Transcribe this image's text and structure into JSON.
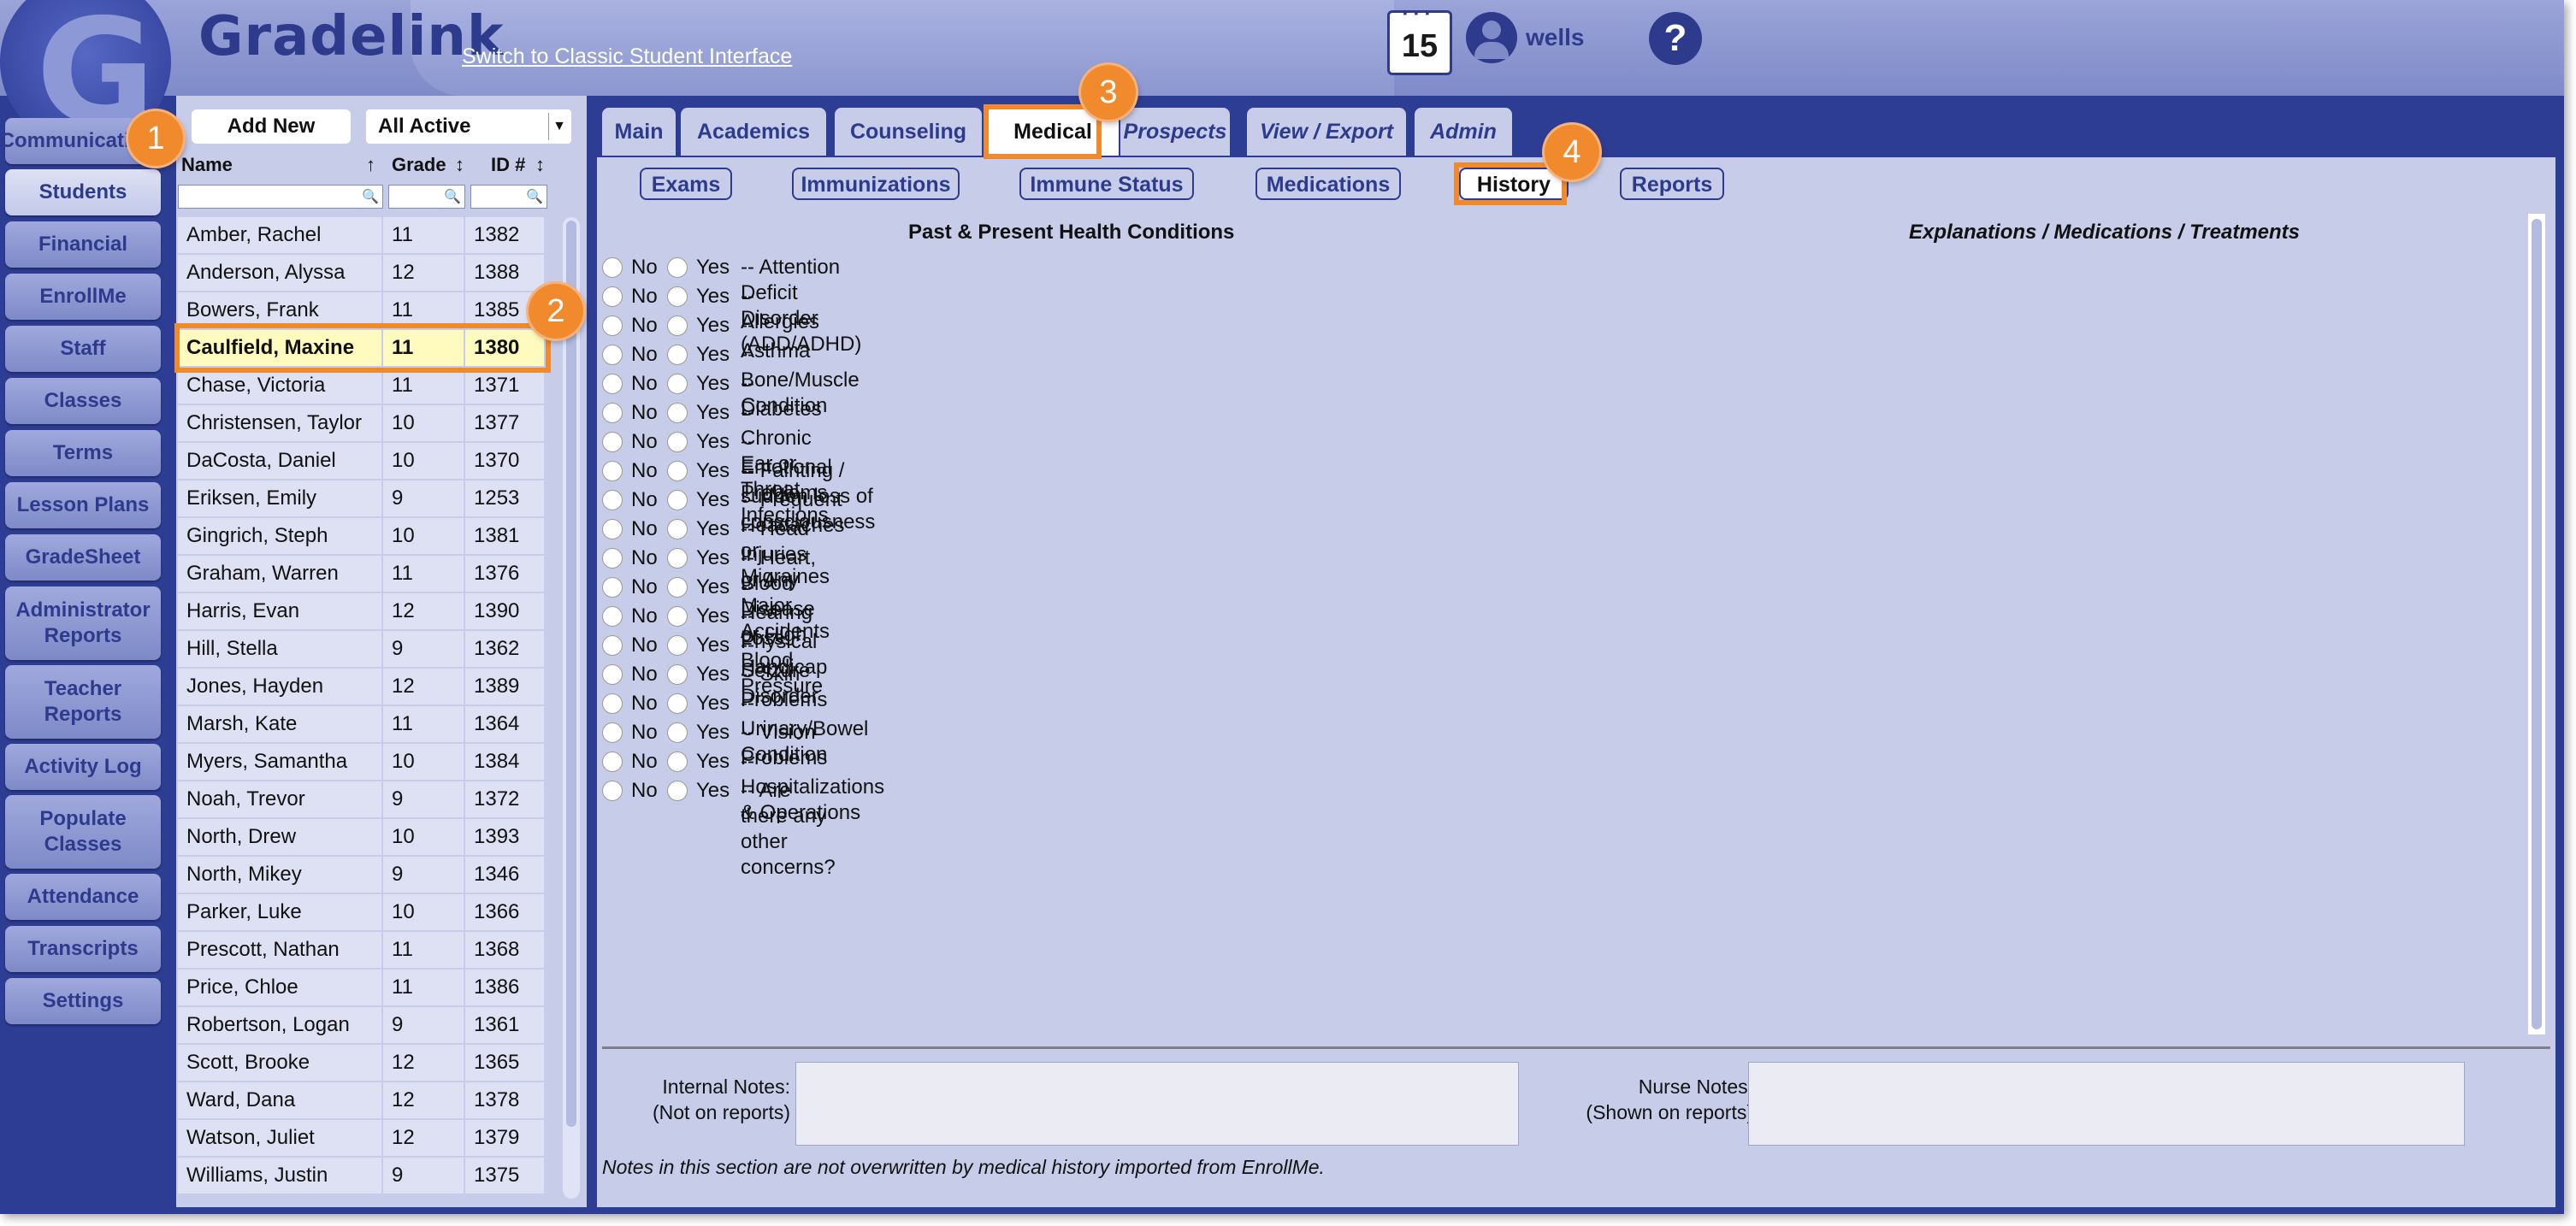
{
  "app": {
    "brand": "Gradelink",
    "classic_link": "Switch to Classic Student Interface",
    "calendar_day": "15",
    "username": "wells",
    "help": "?"
  },
  "sidebar": {
    "items": [
      {
        "label": "Communications"
      },
      {
        "label": "Students"
      },
      {
        "label": "Financial"
      },
      {
        "label": "EnrollMe"
      },
      {
        "label": "Staff"
      },
      {
        "label": "Classes"
      },
      {
        "label": "Terms"
      },
      {
        "label": "Lesson Plans"
      },
      {
        "label": "GradeSheet"
      },
      {
        "label": "Administrator Reports"
      },
      {
        "label": "Teacher Reports"
      },
      {
        "label": "Activity Log"
      },
      {
        "label": "Populate Classes"
      },
      {
        "label": "Attendance"
      },
      {
        "label": "Transcripts"
      },
      {
        "label": "Settings"
      }
    ]
  },
  "list": {
    "add_new": "Add New",
    "filter": "All Active",
    "columns": {
      "name": "Name",
      "grade": "Grade",
      "id": "ID #"
    },
    "students": [
      {
        "name": "Amber, Rachel",
        "grade": "11",
        "id": "1382"
      },
      {
        "name": "Anderson, Alyssa",
        "grade": "12",
        "id": "1388"
      },
      {
        "name": "Bowers, Frank",
        "grade": "11",
        "id": "1385"
      },
      {
        "name": "Caulfield, Maxine",
        "grade": "11",
        "id": "1380"
      },
      {
        "name": "Chase, Victoria",
        "grade": "11",
        "id": "1371"
      },
      {
        "name": "Christensen, Taylor",
        "grade": "10",
        "id": "1377"
      },
      {
        "name": "DaCosta, Daniel",
        "grade": "10",
        "id": "1370"
      },
      {
        "name": "Eriksen, Emily",
        "grade": "9",
        "id": "1253"
      },
      {
        "name": "Gingrich, Steph",
        "grade": "10",
        "id": "1381"
      },
      {
        "name": "Graham, Warren",
        "grade": "11",
        "id": "1376"
      },
      {
        "name": "Harris, Evan",
        "grade": "12",
        "id": "1390"
      },
      {
        "name": "Hill, Stella",
        "grade": "9",
        "id": "1362"
      },
      {
        "name": "Jones, Hayden",
        "grade": "12",
        "id": "1389"
      },
      {
        "name": "Marsh, Kate",
        "grade": "11",
        "id": "1364"
      },
      {
        "name": "Myers, Samantha",
        "grade": "10",
        "id": "1384"
      },
      {
        "name": "Noah, Trevor",
        "grade": "9",
        "id": "1372"
      },
      {
        "name": "North, Drew",
        "grade": "10",
        "id": "1393"
      },
      {
        "name": "North, Mikey",
        "grade": "9",
        "id": "1346"
      },
      {
        "name": "Parker, Luke",
        "grade": "10",
        "id": "1366"
      },
      {
        "name": "Prescott, Nathan",
        "grade": "11",
        "id": "1368"
      },
      {
        "name": "Price, Chloe",
        "grade": "11",
        "id": "1386"
      },
      {
        "name": "Robertson, Logan",
        "grade": "9",
        "id": "1361"
      },
      {
        "name": "Scott, Brooke",
        "grade": "12",
        "id": "1365"
      },
      {
        "name": "Ward, Dana",
        "grade": "12",
        "id": "1378"
      },
      {
        "name": "Watson, Juliet",
        "grade": "12",
        "id": "1379"
      },
      {
        "name": "Williams, Justin",
        "grade": "9",
        "id": "1375"
      }
    ]
  },
  "tabs": [
    {
      "label": "Main"
    },
    {
      "label": "Academics"
    },
    {
      "label": "Counseling"
    },
    {
      "label": "Medical"
    },
    {
      "label": "Prospects"
    },
    {
      "label": "View / Export"
    },
    {
      "label": "Admin"
    }
  ],
  "subtabs": [
    {
      "label": "Exams"
    },
    {
      "label": "Immunizations"
    },
    {
      "label": "Immune Status"
    },
    {
      "label": "Medications"
    },
    {
      "label": "History"
    },
    {
      "label": "Reports"
    }
  ],
  "history": {
    "title": "Past & Present Health Conditions",
    "right_title": "Explanations / Medications / Treatments",
    "no_label": "No",
    "yes_label": "Yes",
    "conditions": [
      "-- Attention Deficit Disorder (ADD/ADHD)",
      "-- Allergies",
      "-- Asthma",
      "-- Bone/Muscle Condition",
      "-- Diabetes",
      "-- Chronic Ear or Throat Infections",
      "-- Emotional Problems",
      "-- Fainting / sudden loss of consciousness",
      "-- Frequent Headaches or Migraines",
      "-- Head Injuries or Any Major Accidents",
      "-- Heart, Blood Disease or High Blood Pressure",
      "-- Hearing Loss",
      "-- Physical Handicap",
      "-- Seizure Disorder",
      "-- Skin Problems",
      "-- Urinary/Bowel Condition",
      "-- Vision Problems",
      "-- Hospitalizations & Operations",
      "-- Are there any other concerns?"
    ]
  },
  "notes": {
    "internal_label": "Internal Notes:",
    "internal_sub": "(Not on reports)",
    "nurse_label": "Nurse Notes:",
    "nurse_sub": "(Shown on reports)",
    "footnote": "Notes in this section are not overwritten by medical history imported from EnrollMe."
  },
  "annotations": [
    "1",
    "2",
    "3",
    "4"
  ],
  "colors": {
    "accent": "#f08a2c",
    "navy": "#2e3d94",
    "panel": "#c7cde9",
    "selected_row": "#fffbbf"
  }
}
